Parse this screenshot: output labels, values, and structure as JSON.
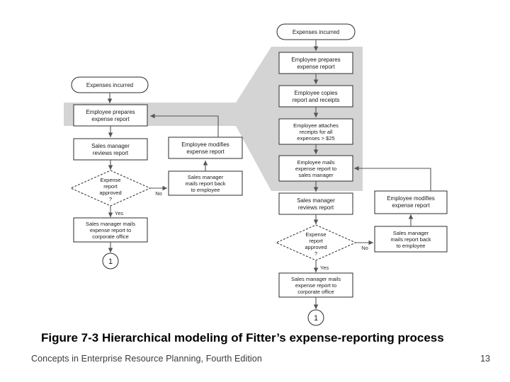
{
  "slide": {
    "caption": "Figure 7-3  Hierarchical modeling of Fitter’s expense-reporting process",
    "footer_text": "Concepts in Enterprise Resource Planning, Fourth Edition",
    "page_number": "13",
    "background_color": "#ffffff",
    "highlight_color": "#d4d4d4",
    "line_color": "#555555",
    "shape_border_color": "#2b2b2b"
  },
  "diagram": {
    "type": "flowchart",
    "description": "Hierarchical (two-level) process model: a high-level expense-reporting flowchart on the left, with the 'Employee prepares expense report' step exploded into a detailed sub-process flowchart on the right.",
    "left_chart": {
      "title_implied": "High-level expense-reporting process",
      "nodes": [
        {
          "id": "l1",
          "shape": "terminator",
          "label": "Expenses incurred"
        },
        {
          "id": "l2",
          "shape": "process",
          "label": "Employee prepares expense report",
          "highlighted": true
        },
        {
          "id": "l3",
          "shape": "process",
          "label": "Sales manager reviews report"
        },
        {
          "id": "l4",
          "shape": "decision",
          "label": "Expense report approved ?"
        },
        {
          "id": "l5",
          "shape": "process",
          "label": "Sales manager mails expense report to corporate office"
        },
        {
          "id": "l6",
          "shape": "connector",
          "label": "1"
        },
        {
          "id": "l7",
          "shape": "process",
          "label": "Sales manager mails report back to employee"
        },
        {
          "id": "l8",
          "shape": "process",
          "label": "Employee modifies expense report"
        }
      ],
      "edges": [
        {
          "from": "l1",
          "to": "l2",
          "label": ""
        },
        {
          "from": "l2",
          "to": "l3",
          "label": ""
        },
        {
          "from": "l3",
          "to": "l4",
          "label": ""
        },
        {
          "from": "l4",
          "to": "l5",
          "label": "Yes"
        },
        {
          "from": "l4",
          "to": "l7",
          "label": "No"
        },
        {
          "from": "l5",
          "to": "l6",
          "label": ""
        },
        {
          "from": "l7",
          "to": "l8",
          "label": ""
        },
        {
          "from": "l8",
          "to": "l2",
          "label": ""
        }
      ]
    },
    "right_chart": {
      "title_implied": "Detailed expense-reporting process",
      "nodes": [
        {
          "id": "r1",
          "shape": "terminator",
          "label": "Expenses incurred"
        },
        {
          "id": "r2",
          "shape": "process",
          "label": "Employee prepares expense report",
          "highlighted": true
        },
        {
          "id": "r3",
          "shape": "process",
          "label": "Employee copies report and receipts",
          "highlighted": true
        },
        {
          "id": "r4",
          "shape": "process",
          "label": "Employee attaches receipts for all expenses > $25",
          "highlighted": true
        },
        {
          "id": "r5",
          "shape": "process",
          "label": "Employee mails expense report to sales manager",
          "highlighted": true
        },
        {
          "id": "r6",
          "shape": "process",
          "label": "Sales manager reviews report"
        },
        {
          "id": "r7",
          "shape": "decision",
          "label": "Expense report approved ?"
        },
        {
          "id": "r8",
          "shape": "process",
          "label": "Sales manager mails expense report to corporate office"
        },
        {
          "id": "r9",
          "shape": "connector",
          "label": "1"
        },
        {
          "id": "r10",
          "shape": "process",
          "label": "Sales manager mails report back to employee"
        },
        {
          "id": "r11",
          "shape": "process",
          "label": "Employee modifies expense report"
        }
      ],
      "edges": [
        {
          "from": "r1",
          "to": "r2",
          "label": ""
        },
        {
          "from": "r2",
          "to": "r3",
          "label": ""
        },
        {
          "from": "r3",
          "to": "r4",
          "label": ""
        },
        {
          "from": "r4",
          "to": "r5",
          "label": ""
        },
        {
          "from": "r5",
          "to": "r6",
          "label": ""
        },
        {
          "from": "r6",
          "to": "r7",
          "label": ""
        },
        {
          "from": "r7",
          "to": "r8",
          "label": "Yes"
        },
        {
          "from": "r7",
          "to": "r10",
          "label": "No"
        },
        {
          "from": "r8",
          "to": "r9",
          "label": ""
        },
        {
          "from": "r10",
          "to": "r11",
          "label": ""
        },
        {
          "from": "r11",
          "to": "r5",
          "label": ""
        }
      ]
    },
    "expansion_wedge": {
      "label": "",
      "from_node": "l2",
      "to_group": [
        "r2",
        "r3",
        "r4",
        "r5"
      ]
    }
  },
  "text": {
    "expenses_incurred": "Expenses incurred",
    "employee_prepares_1": "Employee prepares",
    "employee_prepares_2": "expense report",
    "employee_copies_1": "Employee copies",
    "employee_copies_2": "report and receipts",
    "employee_attaches_1": "Employee attaches",
    "employee_attaches_2": "receipts for all",
    "employee_attaches_3": "expenses > $25",
    "employee_mails_1": "Employee mails",
    "employee_mails_2": "expense report to",
    "employee_mails_3": "sales manager",
    "sm_reviews_1": "Sales manager",
    "sm_reviews_2": "reviews report",
    "decision_1": "Expense",
    "decision_2": "report",
    "decision_3": "approved",
    "decision_4": "?",
    "sm_corporate_1": "Sales manager mails",
    "sm_corporate_2": "expense report to",
    "sm_corporate_3": "corporate office",
    "sm_back_1": "Sales manager",
    "sm_back_2": "mails report back",
    "sm_back_3": "to employee",
    "emp_modifies_1": "Employee modifies",
    "emp_modifies_2": "expense report",
    "yes_label": "Yes",
    "no_label": "No",
    "connector_one": "1"
  }
}
